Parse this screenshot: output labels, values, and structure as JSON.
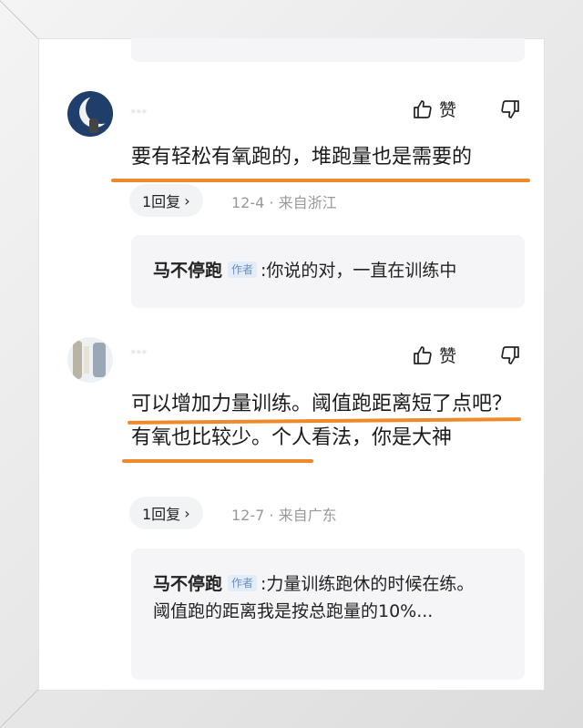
{
  "comments": [
    {
      "username": "···",
      "like_label": "赞",
      "text": "要有轻松有氧跑的，堆跑量也是需要的",
      "reply_count_label": "1回复",
      "reply_chevron": "›",
      "meta": "12-4 · 来自浙江",
      "reply": {
        "author": "马不停跑",
        "tag": "作者",
        "text_lines": [
          ":你说的对，一直在训练中"
        ]
      }
    },
    {
      "username": "···",
      "like_label": "赞",
      "text": "可以增加力量训练。阈值跑距离短了点吧？有氧也比较少。个人看法，你是大神",
      "reply_count_label": "1回复",
      "reply_chevron": "›",
      "meta": "12-7 · 来自广东",
      "reply": {
        "author": "马不停跑",
        "tag": "作者",
        "text_lines": [
          ":力量训练跑休的时候在练。",
          "阈值跑的距离我是按总跑量的10%..."
        ]
      }
    }
  ],
  "colors": {
    "highlight_underline": "#ef8a2b",
    "author_tag": "#6a8fcf",
    "meta_text": "#999999"
  },
  "icons": {
    "like": "thumbs-up-icon",
    "dislike": "thumbs-down-icon",
    "chevron": "chevron-right-icon"
  }
}
